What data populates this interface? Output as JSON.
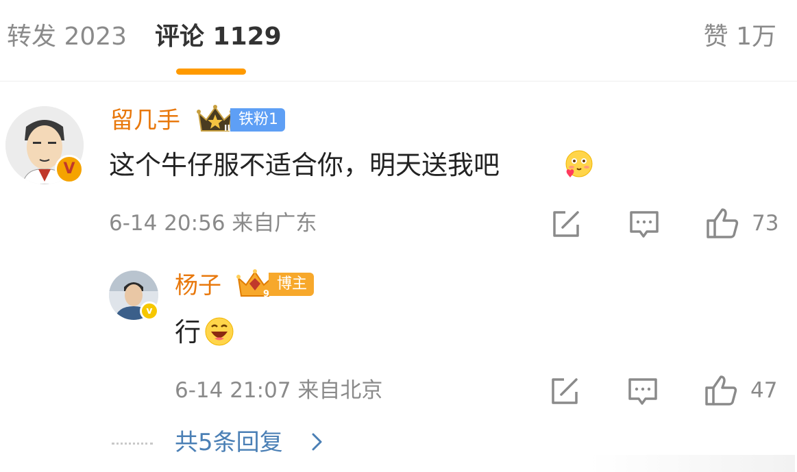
{
  "tabs": {
    "repost": "转发 2023",
    "comments": "评论 1129",
    "likes": "赞 1万"
  },
  "comments": [
    {
      "username": "留几手",
      "badge": "铁粉1",
      "text": "这个牛仔服不适合你，明天送我吧",
      "meta": "6-14 20:56  来自广东",
      "like_count": "73",
      "emoji_icon": "blush-heart-emoji"
    },
    {
      "username": "杨子",
      "badge": "博主",
      "text": "行",
      "meta": "6-14 21:07  来自北京",
      "like_count": "47",
      "emoji_icon": "laughing-emoji"
    }
  ],
  "replies_link": "共5条回复",
  "colors": {
    "accent": "#ff9a00",
    "username": "#e8780c",
    "link": "#4a7fb5",
    "fan_badge": "#5e9ff5",
    "host_badge": "#f7a82b"
  }
}
